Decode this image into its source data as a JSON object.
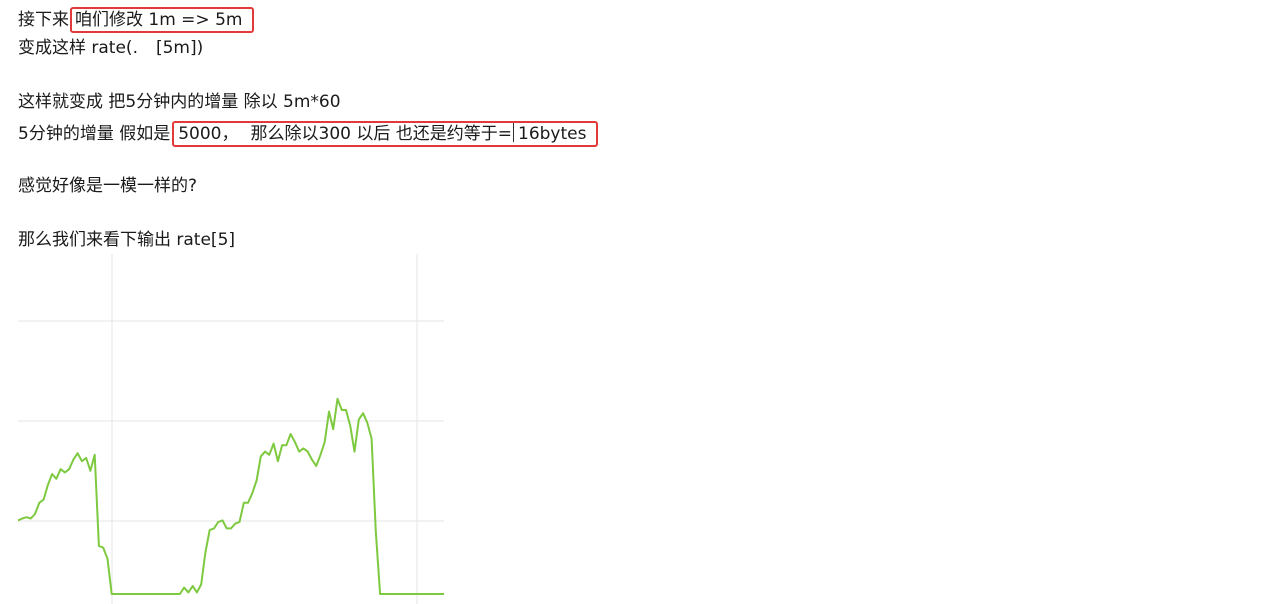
{
  "notes": {
    "line1": {
      "prefix": "接下来",
      "highlight": "咱们修改 1m => 5m"
    },
    "line2": {
      "part1": "变成这样 rate(.",
      "part2": "[5m])"
    },
    "line3": {
      "text": "这样就变成 把5分钟内的增量 除以 5m*60"
    },
    "line4": {
      "prefix": "5分钟的增量 假如是",
      "highlight_part1": "5000，",
      "highlight_part2": "那么除以300 以后  也还是约等于=",
      "highlight_part3": "16bytes"
    },
    "line5": {
      "text": "感觉好像是一模一样的?"
    },
    "line6": {
      "text": "那么我们来看下输出 rate[5]"
    }
  },
  "colors": {
    "highlight_border": "#e23a3a",
    "series_line": "#7dc93f",
    "gridline": "#e4e4e4",
    "text": "#1a1a1a"
  },
  "chart_data": {
    "type": "line",
    "title": "",
    "xlabel": "",
    "ylabel": "",
    "grid": true,
    "legend": "none",
    "xlim": [
      0,
      100
    ],
    "ylim": [
      0,
      100
    ],
    "series": [
      {
        "values": [
          [
            0,
            23.0
          ],
          [
            1,
            23.6
          ],
          [
            2,
            24.0
          ],
          [
            3,
            23.6
          ],
          [
            4,
            25.0
          ],
          [
            5,
            28.5
          ],
          [
            6,
            29.5
          ],
          [
            7,
            34.0
          ],
          [
            8,
            37.5
          ],
          [
            9,
            36.0
          ],
          [
            10,
            39.0
          ],
          [
            11,
            38.0
          ],
          [
            12,
            39.0
          ],
          [
            13,
            42.0
          ],
          [
            14,
            44.0
          ],
          [
            15,
            41.5
          ],
          [
            16,
            42.5
          ],
          [
            17,
            38.5
          ],
          [
            18,
            43.5
          ],
          [
            19,
            15.0
          ],
          [
            20,
            14.5
          ],
          [
            21,
            11.0
          ],
          [
            22,
            0.0
          ],
          [
            23,
            0.0
          ],
          [
            24,
            0.0
          ],
          [
            25,
            0.0
          ],
          [
            26,
            0.0
          ],
          [
            27,
            0.0
          ],
          [
            28,
            0.0
          ],
          [
            29,
            0.0
          ],
          [
            30,
            0.0
          ],
          [
            31,
            0.0
          ],
          [
            32,
            0.0
          ],
          [
            33,
            0.0
          ],
          [
            34,
            0.0
          ],
          [
            35,
            0.0
          ],
          [
            36,
            0.0
          ],
          [
            37,
            0.0
          ],
          [
            38,
            0.0
          ],
          [
            39,
            2.0
          ],
          [
            40,
            0.5
          ],
          [
            41,
            2.5
          ],
          [
            42,
            0.5
          ],
          [
            43,
            3.0
          ],
          [
            44,
            13.0
          ],
          [
            45,
            20.0
          ],
          [
            46,
            20.5
          ],
          [
            47,
            22.5
          ],
          [
            48,
            23.0
          ],
          [
            49,
            20.5
          ],
          [
            50,
            20.5
          ],
          [
            51,
            22.0
          ],
          [
            52,
            22.5
          ],
          [
            53,
            28.5
          ],
          [
            54,
            28.5
          ],
          [
            55,
            31.5
          ],
          [
            56,
            35.5
          ],
          [
            57,
            43.0
          ],
          [
            58,
            44.5
          ],
          [
            59,
            43.5
          ],
          [
            60,
            47.0
          ],
          [
            61,
            41.5
          ],
          [
            62,
            46.5
          ],
          [
            63,
            46.5
          ],
          [
            64,
            50.0
          ],
          [
            65,
            47.5
          ],
          [
            66,
            44.5
          ],
          [
            67,
            45.5
          ],
          [
            68,
            44.5
          ],
          [
            69,
            42.0
          ],
          [
            70,
            40.0
          ],
          [
            71,
            43.5
          ],
          [
            72,
            47.5
          ],
          [
            73,
            57.0
          ],
          [
            74,
            51.5
          ],
          [
            75,
            61.0
          ],
          [
            76,
            57.5
          ],
          [
            77,
            57.5
          ],
          [
            78,
            52.5
          ],
          [
            79,
            44.5
          ],
          [
            80,
            54.5
          ],
          [
            81,
            56.5
          ],
          [
            82,
            53.5
          ],
          [
            83,
            48.5
          ],
          [
            84,
            19.5
          ],
          [
            85,
            0.0
          ],
          [
            86,
            0.0
          ],
          [
            87,
            0.0
          ],
          [
            88,
            0.0
          ],
          [
            89,
            0.0
          ],
          [
            90,
            0.0
          ],
          [
            91,
            0.0
          ],
          [
            92,
            0.0
          ],
          [
            93,
            0.0
          ],
          [
            94,
            0.0
          ],
          [
            95,
            0.0
          ],
          [
            96,
            0.0
          ],
          [
            97,
            0.0
          ],
          [
            98,
            0.0
          ],
          [
            99,
            0.0
          ],
          [
            100,
            0.0
          ]
        ]
      }
    ]
  }
}
